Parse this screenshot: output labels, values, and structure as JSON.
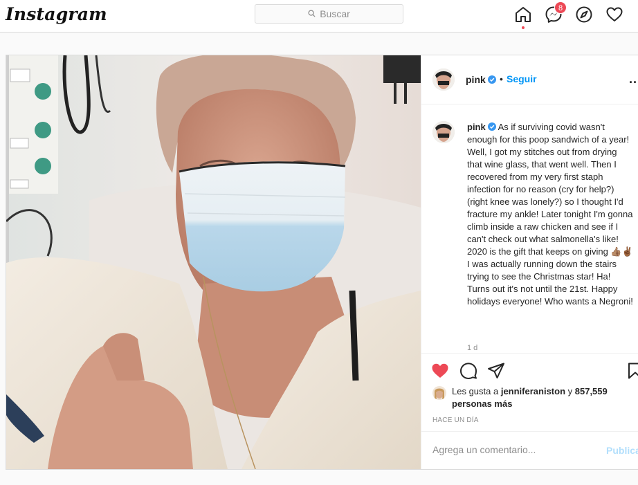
{
  "nav": {
    "logo": "Instagram",
    "search_placeholder": "Buscar",
    "messages_badge": "8",
    "icons": [
      "home-icon",
      "messenger-icon",
      "explore-icon",
      "heart-icon"
    ]
  },
  "post": {
    "username": "pink",
    "follow_label": "Seguir",
    "dot": "•",
    "more": "...",
    "caption_user": "pink",
    "caption_text": "As if surviving covid wasn't enough for this poop sandwich of a year! Well, I got my stitches out from drying that wine glass, that went well. Then I recovered from my very first staph infection for no reason (cry for help?) (right knee was lonely?) so I thought I'd fracture my ankle! Later tonight I'm gonna climb inside a raw chicken and see if I can't check out what salmonella's like! 2020 is the gift that keeps on giving 👍🏽✌🏾 I was actually running down the stairs trying to see the Christmas star! Ha! Turns out it's not until the 21st. Happy holidays everyone! Who wants a Negroni!",
    "caption_time": "1 d",
    "likes_prefix": "Les gusta a ",
    "likes_user": "jenniferaniston",
    "likes_mid": " y ",
    "likes_count": "857,559 personas más",
    "timestamp": "HACE UN DÍA",
    "comment_placeholder": "Agrega un comentario...",
    "publish_label": "Publicar",
    "liked": true,
    "colors": {
      "like_red": "#ed4956",
      "link_blue": "#0095f6",
      "publish_disabled": "#b2dffc"
    }
  }
}
